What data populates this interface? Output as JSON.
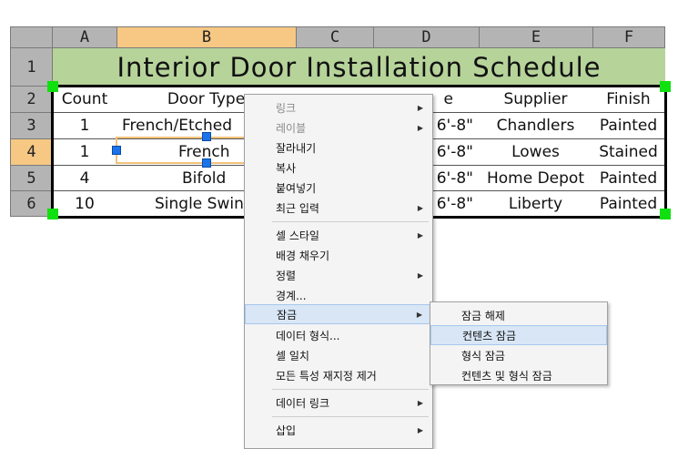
{
  "columns": [
    "A",
    "B",
    "C",
    "D",
    "E",
    "F"
  ],
  "rows": [
    "1",
    "2",
    "3",
    "4",
    "5",
    "6"
  ],
  "table": {
    "title": "Interior Door Installation Schedule",
    "header": [
      "Count",
      "Door Type",
      "",
      "e",
      "Supplier",
      "Finish"
    ],
    "body": [
      [
        "1",
        "French/Etched",
        "",
        "6'-8\"",
        "Chandlers",
        "Painted"
      ],
      [
        "1",
        "French",
        "",
        "6'-8\"",
        "Lowes",
        "Stained"
      ],
      [
        "4",
        "Bifold",
        "",
        "6'-8\"",
        "Home Depot",
        "Painted"
      ],
      [
        "10",
        "Single Swin",
        "",
        "6'-8\"",
        "Liberty",
        "Painted"
      ]
    ]
  },
  "context_menu": {
    "items": [
      {
        "label": "링크",
        "disabled": true,
        "submenu": true
      },
      {
        "label": "레이블",
        "disabled": true,
        "submenu": true
      },
      {
        "label": "잘라내기"
      },
      {
        "label": "복사"
      },
      {
        "label": "붙여넣기"
      },
      {
        "label": "최근 입력",
        "submenu": true
      },
      {
        "label": "셀 스타일",
        "submenu": true
      },
      {
        "label": "배경 채우기"
      },
      {
        "label": "정렬",
        "submenu": true
      },
      {
        "label": "경계..."
      },
      {
        "label": "잠금",
        "submenu": true,
        "highlighted": true
      },
      {
        "label": "데이터 형식..."
      },
      {
        "label": "셀 일치"
      },
      {
        "label": "모든 특성 재지정 제거"
      },
      {
        "label": "데이터 링크",
        "submenu": true
      },
      {
        "label": "삽입",
        "submenu": true
      }
    ]
  },
  "lock_submenu": {
    "items": [
      {
        "label": "잠금 해제"
      },
      {
        "label": "컨텐츠 잠금",
        "highlighted": true
      },
      {
        "label": "형식 잠금"
      },
      {
        "label": "컨텐츠 및 형식 잠금"
      }
    ]
  },
  "icons": {
    "submenu_arrow": "submenu-arrow-icon"
  },
  "colors": {
    "title_bg": "#b6d39a",
    "selected_header": "#f6c884",
    "grip": "#10e010",
    "handle": "#1a73e8"
  }
}
